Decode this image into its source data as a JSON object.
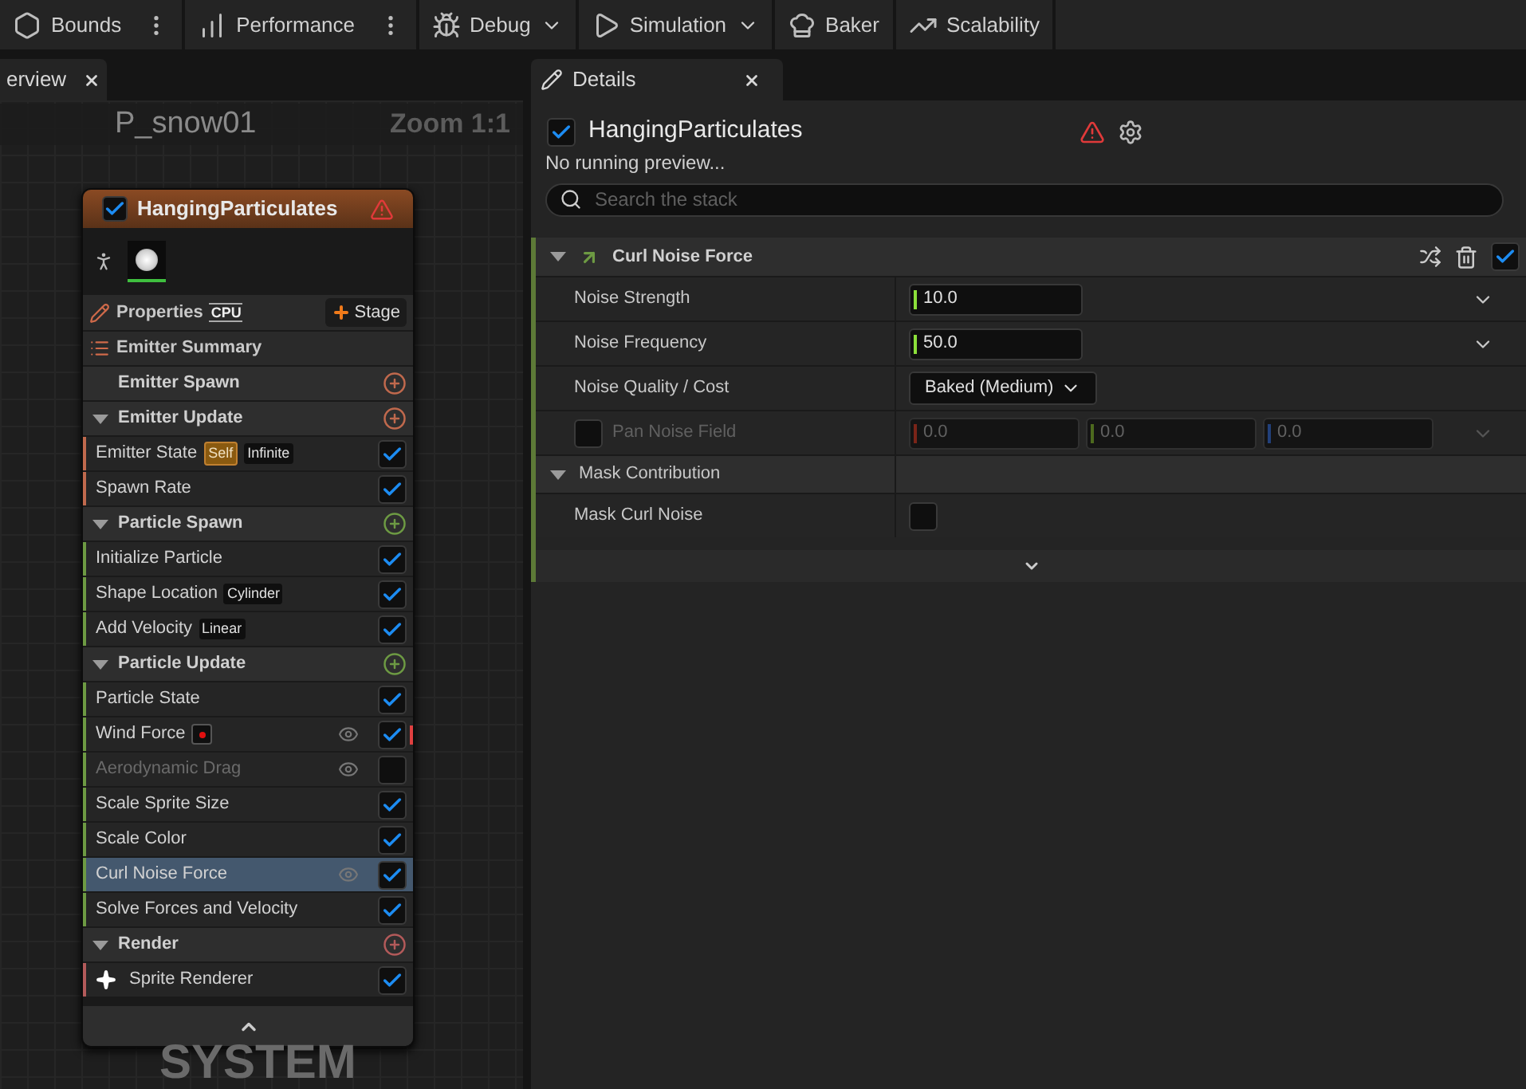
{
  "toolbar": [
    {
      "label": "Bounds",
      "more": true,
      "dropdown": false
    },
    {
      "label": "Performance",
      "more": true,
      "dropdown": false
    },
    {
      "label": "Debug",
      "more": false,
      "dropdown": true
    },
    {
      "label": "Simulation",
      "more": false,
      "dropdown": true
    },
    {
      "label": "Baker",
      "more": false,
      "dropdown": false
    },
    {
      "label": "Scalability",
      "more": false,
      "dropdown": false
    }
  ],
  "left_tab": {
    "label": "erview"
  },
  "graph": {
    "title": "P_snow01",
    "zoom": "Zoom 1:1",
    "watermark": "SYSTEM"
  },
  "emitter": {
    "name": "HangingParticulates",
    "enabled": true,
    "warning": true,
    "properties": "Properties",
    "sim_target": "CPU",
    "add_stage": "Stage",
    "summary": "Emitter Summary",
    "groups": [
      {
        "label": "Emitter Spawn",
        "color": "#c0694d"
      },
      {
        "label": "Emitter Update",
        "color": "#c0694d",
        "items": [
          {
            "label": "Emitter State",
            "enabled": true,
            "selected": false,
            "eye": false,
            "issue": false,
            "tags": [
              {
                "text": "Self",
                "kind": "highlight"
              },
              {
                "text": "Infinite",
                "kind": "plain"
              }
            ]
          },
          {
            "label": "Spawn Rate",
            "enabled": true,
            "selected": false,
            "eye": false,
            "issue": false
          }
        ]
      },
      {
        "label": "Particle Spawn",
        "color": "#6d9a43",
        "items": [
          {
            "label": "Initialize Particle",
            "enabled": true,
            "selected": false,
            "eye": false,
            "issue": false
          },
          {
            "label": "Shape Location",
            "enabled": true,
            "selected": false,
            "eye": false,
            "issue": false,
            "tags": [
              {
                "text": "Cylinder",
                "kind": "plain"
              }
            ]
          },
          {
            "label": "Add Velocity",
            "enabled": true,
            "selected": false,
            "eye": false,
            "issue": false,
            "tags": [
              {
                "text": "Linear",
                "kind": "plain"
              }
            ]
          }
        ]
      },
      {
        "label": "Particle Update",
        "color": "#6d9a43",
        "items": [
          {
            "label": "Particle State",
            "enabled": true,
            "selected": false,
            "eye": false,
            "issue": false
          },
          {
            "label": "Wind Force",
            "enabled": true,
            "selected": false,
            "eye": true,
            "issue": true
          },
          {
            "label": "Aerodynamic Drag",
            "enabled": false,
            "selected": false,
            "eye": true,
            "issue": false
          },
          {
            "label": "Scale Sprite Size",
            "enabled": true,
            "selected": false,
            "eye": false,
            "issue": false
          },
          {
            "label": "Scale Color",
            "enabled": true,
            "selected": false,
            "eye": false,
            "issue": false
          },
          {
            "label": "Curl Noise Force",
            "enabled": true,
            "selected": true,
            "eye": true,
            "issue": false
          },
          {
            "label": "Solve Forces and Velocity",
            "enabled": true,
            "selected": false,
            "eye": false,
            "issue": false
          }
        ]
      },
      {
        "label": "Render",
        "color": "#b35a5a",
        "items": [
          {
            "label": "Sprite Renderer",
            "enabled": true,
            "selected": false,
            "eye": false,
            "issue": false,
            "kind": "renderer"
          }
        ]
      }
    ]
  },
  "details": {
    "tab": "Details",
    "title": "HangingParticulates",
    "enabled": true,
    "warning": true,
    "status": "No running preview...",
    "search": {
      "placeholder": "Search the stack"
    },
    "module": {
      "name": "Curl Noise Force",
      "enabled": true,
      "params": [
        {
          "kind": "float",
          "label": "Noise Strength",
          "value": "10.0"
        },
        {
          "kind": "float",
          "label": "Noise Frequency",
          "value": "50.0"
        },
        {
          "kind": "dropdown",
          "label": "Noise Quality / Cost",
          "value": "Baked (Medium)"
        },
        {
          "kind": "vector",
          "label": "Pan Noise Field",
          "checked": false,
          "values": [
            "0.0",
            "0.0",
            "0.0"
          ]
        },
        {
          "kind": "category",
          "label": "Mask Contribution"
        },
        {
          "kind": "bool",
          "label": "Mask Curl Noise",
          "checked": false
        }
      ]
    }
  }
}
